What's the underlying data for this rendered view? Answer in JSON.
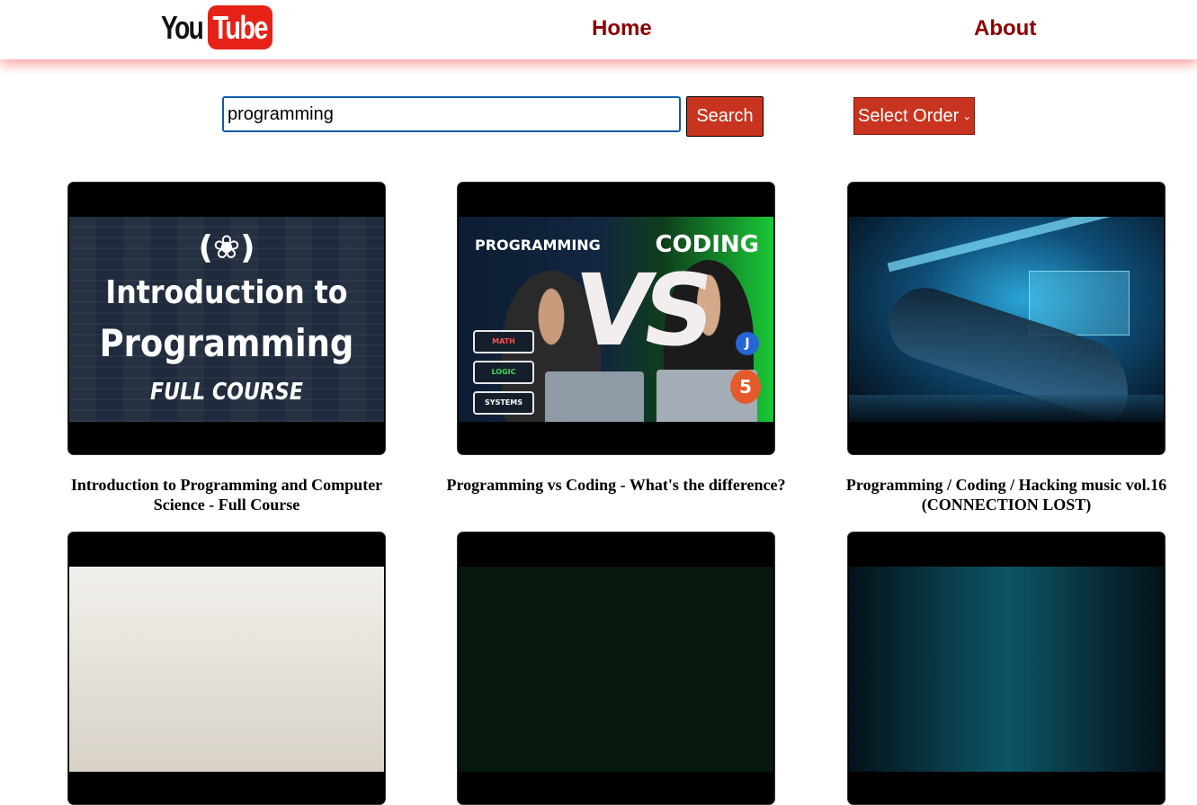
{
  "navbar": {
    "logo": {
      "you": "You",
      "tube": "Tube"
    },
    "links": [
      {
        "label": "Home"
      },
      {
        "label": "About"
      }
    ]
  },
  "search": {
    "value": "programming",
    "button_label": "Search"
  },
  "order_select": {
    "selected": "Select Order"
  },
  "videos": [
    {
      "title": "Introduction to Programming and Computer Science - Full Course",
      "thumbnail_text": {
        "icon": "(❀)",
        "line1": "Introduction to",
        "line2": "Programming",
        "line3": "FULL COURSE"
      }
    },
    {
      "title": "Programming vs Coding - What's the difference?",
      "thumbnail_text": {
        "left": "PROGRAMMING",
        "right": "CODING",
        "vs": "VS",
        "tags": [
          "MATH",
          "LOGIC",
          "SYSTEMS"
        ],
        "badge_js": "J",
        "badge_html": "5"
      }
    },
    {
      "title": "Programming / Coding / Hacking music vol.16 (CONNECTION LOST)"
    },
    {
      "title": ""
    },
    {
      "title": ""
    },
    {
      "title": ""
    }
  ],
  "colors": {
    "nav_link": "#8b0000",
    "accent_button": "#c8341f",
    "logo_red": "#e62117",
    "input_border": "#0b5cad"
  }
}
